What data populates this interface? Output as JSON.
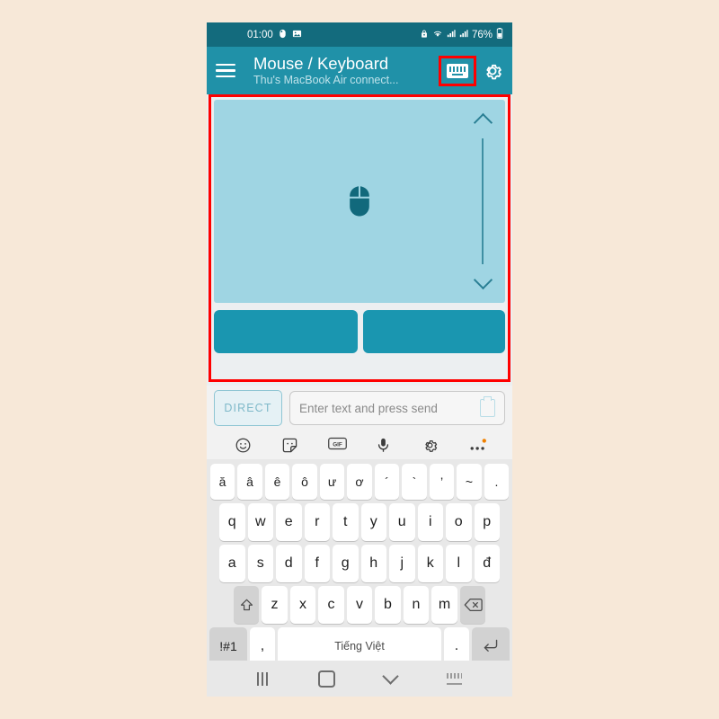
{
  "statusbar": {
    "time": "01:00",
    "left_icons": [
      "mouse-icon",
      "image-icon"
    ],
    "battery_text": "76%",
    "right_icons": [
      "alarm-lock-icon",
      "wifi-icon",
      "signal-icon-1",
      "signal-icon-2",
      "battery-icon"
    ]
  },
  "appbar": {
    "menu_icon": "hamburger-icon",
    "title": "Mouse / Keyboard",
    "subtitle": "Thu's MacBook Air connect...",
    "keyboard_toggle_icon": "keyboard-icon",
    "settings_icon": "gear-icon",
    "bar_color": "#2091a8",
    "highlight_color": "#ff0000"
  },
  "touchpad": {
    "center_icon": "mouse-icon",
    "scroll_up_icon": "chevron-up-icon",
    "scroll_down_icon": "chevron-down-icon",
    "pad_color": "#9fd5e3",
    "button_color": "#1a96b0",
    "left_click_label": "",
    "right_click_label": ""
  },
  "input": {
    "mode_button_label": "DIRECT",
    "placeholder": "Enter text and press send",
    "value": "",
    "clipboard_icon": "clipboard-icon"
  },
  "keyboard_toolbar": {
    "items": [
      {
        "icon": "emoji-icon"
      },
      {
        "icon": "sticker-icon"
      },
      {
        "icon": "gif-icon",
        "label": "GIF"
      },
      {
        "icon": "microphone-icon"
      },
      {
        "icon": "gear-icon"
      },
      {
        "icon": "more-options-icon",
        "badge": true
      }
    ],
    "badge_color": "#f08000"
  },
  "keyboard": {
    "row1": [
      "ă",
      "â",
      "ê",
      "ô",
      "ư",
      "ơ",
      "´",
      "`",
      "’",
      "~",
      "."
    ],
    "row2": [
      "q",
      "w",
      "e",
      "r",
      "t",
      "y",
      "u",
      "i",
      "o",
      "p"
    ],
    "row3": [
      "a",
      "s",
      "d",
      "f",
      "g",
      "h",
      "j",
      "k",
      "l",
      "đ"
    ],
    "row4": {
      "shift_icon": "shift-icon",
      "keys": [
        "z",
        "x",
        "c",
        "v",
        "b",
        "n",
        "m"
      ],
      "backspace_icon": "backspace-icon"
    },
    "row5": {
      "symbols_label": "!#1",
      "comma": ",",
      "space_label": "Tiếng Việt",
      "period": ".",
      "enter_icon": "enter-icon"
    }
  },
  "navbar": {
    "recents_icon": "recents-icon",
    "home_icon": "home-icon",
    "hide_keyboard_icon": "chevron-down-icon",
    "switch_keyboard_icon": "keyboard-switch-icon"
  }
}
